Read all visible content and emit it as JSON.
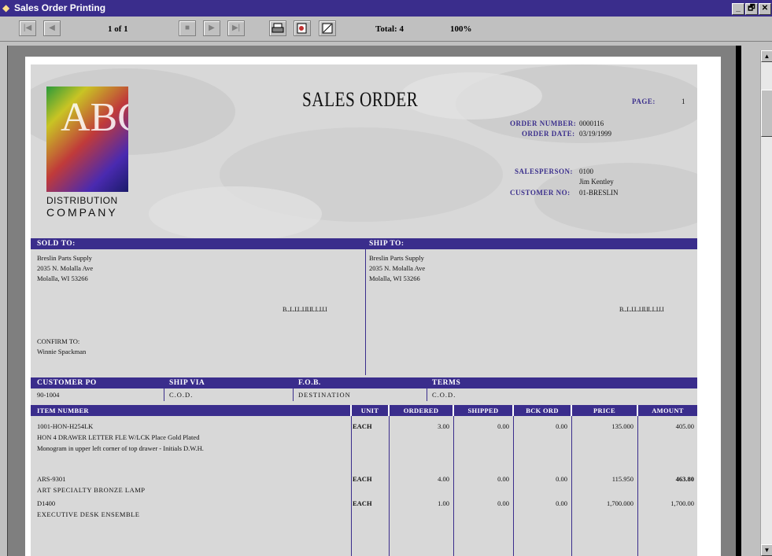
{
  "window": {
    "title": "Sales Order Printing",
    "controls": [
      "_",
      "🗗",
      "✕"
    ]
  },
  "toolbar": {
    "page_indicator": "1 of 1",
    "total": "Total: 4",
    "zoom": "100%"
  },
  "report": {
    "logo": {
      "letters": "ABC",
      "line1": "DISTRIBUTION",
      "line2": "COMPANY"
    },
    "heading": "SALES ORDER",
    "page_label": "PAGE:",
    "page_value": "1",
    "order_number_label": "ORDER NUMBER:",
    "order_number": "0000116",
    "order_date_label": "ORDER DATE:",
    "order_date": "03/19/1999",
    "salesperson_label": "SALESPERSON:",
    "salesperson_code": "0100",
    "salesperson_name": "Jim Kentley",
    "customer_no_label": "CUSTOMER NO:",
    "customer_no": "01-BRESLIN",
    "sold_to_label": "SOLD TO:",
    "sold_to": [
      "Breslin Parts Supply",
      "2035 N. Molalla Ave",
      "Molalla, WI 53266"
    ],
    "ship_to_label": "SHIP TO:",
    "ship_to": [
      "Breslin Parts Supply",
      "2035 N. Molalla Ave",
      "Molalla, WI 53266"
    ],
    "barcode_text": "B...L.I.L.I.II.II..I..I.I.I",
    "confirm_label": "CONFIRM TO:",
    "confirm_name": "Winnie Spackman",
    "info_headers": [
      "CUSTOMER PO",
      "SHIP VIA",
      "F.O.B.",
      "TERMS"
    ],
    "info_values": [
      "90-1004",
      "C.O.D.",
      "DESTINATION",
      "C.O.D."
    ],
    "item_headers": [
      "ITEM NUMBER",
      "UNIT",
      "ORDERED",
      "SHIPPED",
      "BCK ORD",
      "PRICE",
      "AMOUNT"
    ],
    "items": [
      {
        "number": "1001-HON-H254LK",
        "unit": "EACH",
        "ordered": "3.00",
        "shipped": "0.00",
        "bck": "0.00",
        "price": "135.000",
        "amount": "405.00",
        "desc": "HON 4 DRAWER LETTER FLE W/LCK Place Gold Plated",
        "note": "Monogram in upper left corner of top drawer - Initials D.W.H."
      },
      {
        "number": "ARS-9301",
        "unit": "EACH",
        "ordered": "4.00",
        "shipped": "0.00",
        "bck": "0.00",
        "price": "115.950",
        "amount": "463.80",
        "desc": "ART SPECIALTY BRONZE LAMP",
        "note": ""
      },
      {
        "number": "D1400",
        "unit": "EACH",
        "ordered": "1.00",
        "shipped": "0.00",
        "bck": "0.00",
        "price": "1,700.000",
        "amount": "1,700.00",
        "desc": "EXECUTIVE DESK ENSEMBLE",
        "note": ""
      }
    ]
  },
  "colors": {
    "accent": "#3a2d8c",
    "paper": "#ffffff",
    "doc_bg": "#d8d8d8",
    "workspace": "#7f7f7f"
  }
}
